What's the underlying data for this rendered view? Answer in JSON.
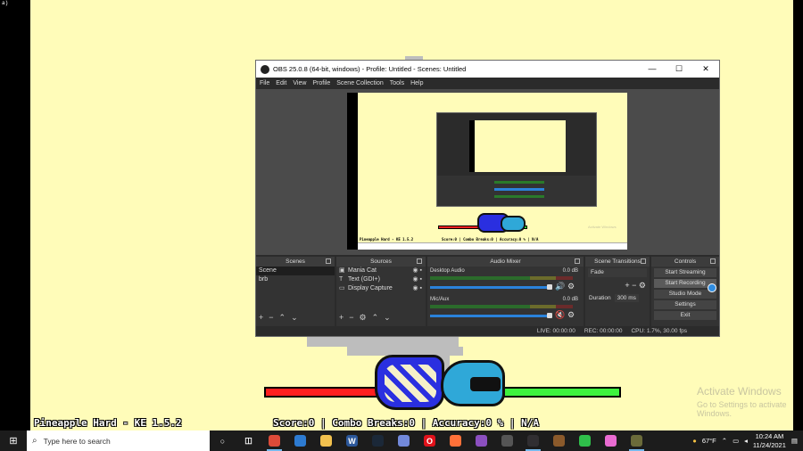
{
  "corner_mark": "a)",
  "game": {
    "song_label": "Pineapple Hard - KE 1.5.2",
    "score_line": "Score:0 | Combo Breaks:0 | Accuracy:0 % | N/A",
    "activate_title": "Activate Windows",
    "activate_sub": "Go to Settings to activate Windows."
  },
  "obs": {
    "title": "OBS 25.0.8 (64-bit, windows) - Profile: Untitled - Scenes: Untitled",
    "window_controls": [
      "—",
      "☐",
      "✕"
    ],
    "menu": [
      "File",
      "Edit",
      "View",
      "Profile",
      "Scene Collection",
      "Tools",
      "Help"
    ],
    "docks": {
      "scenes": {
        "title": "Scenes",
        "items": [
          "Scene",
          "brb"
        ]
      },
      "sources": {
        "title": "Sources",
        "items": [
          {
            "icon": "image-icon",
            "glyph": "▣",
            "label": "Mania Cat"
          },
          {
            "icon": "text-icon",
            "glyph": "T",
            "label": "Text (GDI+)"
          },
          {
            "icon": "monitor-icon",
            "glyph": "▭",
            "label": "Display Capture"
          }
        ]
      },
      "mixer": {
        "title": "Audio Mixer",
        "channels": [
          {
            "name": "Desktop Audio",
            "db": "0.0 dB"
          },
          {
            "name": "Mic/Aux",
            "db": "0.0 dB"
          }
        ]
      },
      "transitions": {
        "title": "Scene Transitions",
        "selected": "Fade",
        "duration_label": "Duration",
        "duration_value": "300 ms"
      },
      "controls": {
        "title": "Controls",
        "buttons": [
          "Start Streaming",
          "Start Recording",
          "Studio Mode",
          "Settings",
          "Exit"
        ]
      }
    },
    "status": {
      "live": "LIVE: 00:00:00",
      "rec": "REC: 00:00:00",
      "cpu": "CPU: 1.7%, 30.00 fps"
    }
  },
  "taskbar": {
    "search_placeholder": "Type here to search",
    "apps": [
      {
        "name": "cortana-icon",
        "glyph": "○",
        "color": "#1c1c1c"
      },
      {
        "name": "task-view-icon",
        "glyph": "◫",
        "color": "#1c1c1c"
      },
      {
        "name": "chrome-icon",
        "glyph": "",
        "color": "#dd4b39"
      },
      {
        "name": "edge-icon",
        "glyph": "",
        "color": "#2d7bd1"
      },
      {
        "name": "file-explorer-icon",
        "glyph": "",
        "color": "#f2c14e"
      },
      {
        "name": "word-icon",
        "glyph": "W",
        "color": "#2b579a"
      },
      {
        "name": "steam-icon",
        "glyph": "",
        "color": "#1b2838"
      },
      {
        "name": "discord-icon",
        "glyph": "",
        "color": "#7289da"
      },
      {
        "name": "opera-icon",
        "glyph": "O",
        "color": "#e0121b"
      },
      {
        "name": "browser-icon",
        "glyph": "",
        "color": "#ff7139"
      },
      {
        "name": "headphones-icon",
        "glyph": "",
        "color": "#8b4fbf"
      },
      {
        "name": "fnf-engine-icon",
        "glyph": "",
        "color": "#555555"
      },
      {
        "name": "obs-icon",
        "glyph": "",
        "color": "#302e31"
      },
      {
        "name": "minecraft-icon",
        "glyph": "",
        "color": "#8b5a2b"
      },
      {
        "name": "gamepad-icon",
        "glyph": "",
        "color": "#2fbf4a"
      },
      {
        "name": "paint-icon",
        "glyph": "",
        "color": "#e96bd1"
      },
      {
        "name": "game-icon",
        "glyph": "",
        "color": "#6b6b3a"
      }
    ],
    "weather": "67°F",
    "time": "10:24 AM",
    "date": "11/24/2021"
  }
}
